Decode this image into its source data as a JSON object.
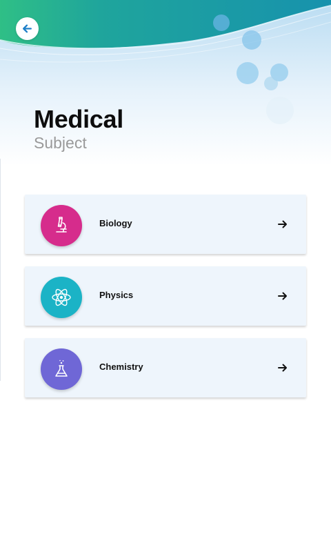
{
  "header": {
    "title": "Medical",
    "subtitle": "Subject",
    "back_icon": "arrow-left-icon"
  },
  "subjects": [
    {
      "label": "Biology",
      "icon": "microscope-icon",
      "color": "#d62c8c"
    },
    {
      "label": "Physics",
      "icon": "atom-icon",
      "color": "#1bb3c6"
    },
    {
      "label": "Chemistry",
      "icon": "flask-icon",
      "color": "#6f67d6"
    }
  ],
  "colors": {
    "wave_teal": "#1a9aa8",
    "wave_green": "#2ebf8a",
    "accent_blue": "#1e7fc8",
    "card_bg": "#eef5fc"
  }
}
